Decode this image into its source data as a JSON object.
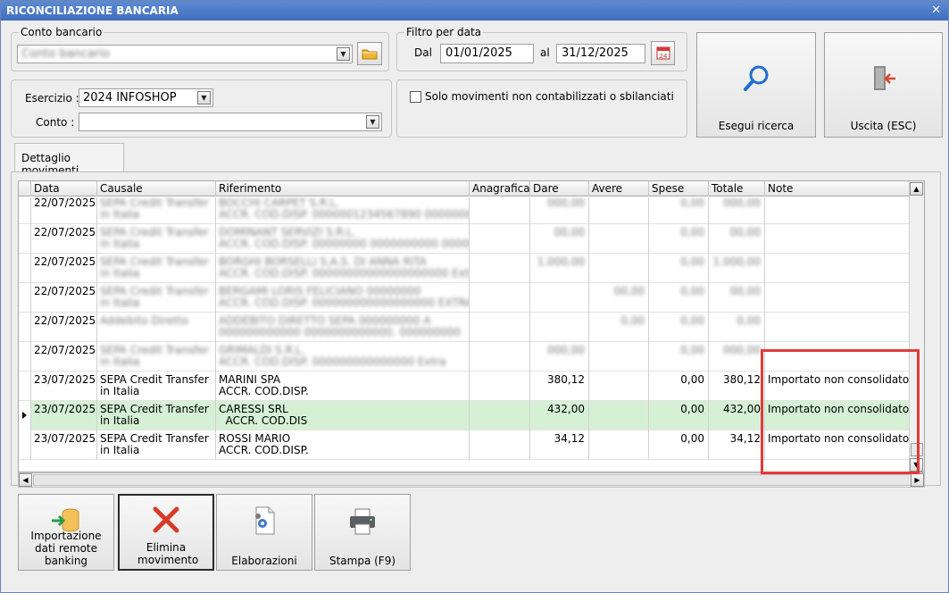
{
  "window": {
    "title": "RICONCILIAZIONE BANCARIA",
    "close": "✕"
  },
  "conto_bancario": {
    "group_label": "Conto bancario",
    "value": "Conto bancario"
  },
  "filtro": {
    "group_label": "Filtro per data",
    "dal_label": "Dal",
    "dal": "01/01/2025",
    "al_label": "al",
    "al": "31/12/2025"
  },
  "esercizio": {
    "label": "Esercizio :",
    "value": "2024 INFOSHOP"
  },
  "conto": {
    "label": "Conto :",
    "value": ""
  },
  "checkbox": {
    "label": "Solo movimenti non contabilizzati o sbilanciati",
    "checked": false
  },
  "buttons": {
    "search": "Esegui ricerca",
    "exit": "Uscita (ESC)"
  },
  "tab": {
    "label": "Dettaglio movimenti"
  },
  "grid": {
    "columns": [
      "Data",
      "Causale",
      "Riferimento",
      "Anagrafica",
      "Dare",
      "Avere",
      "Spese",
      "Totale",
      "Note"
    ],
    "rows": [
      {
        "data": "22/07/2025",
        "causale1": "SEPA Credit Transfer",
        "causale2": "in Italia",
        "rif1": "BOCCHI CARPET S.R.L.",
        "rif2": "ACCR. COD.DISP. 0000001234567890 00000000",
        "dare": "000,00",
        "avere": "",
        "spese": "0,00",
        "totale": "000,00",
        "note": ""
      },
      {
        "data": "22/07/2025",
        "causale1": "SEPA Credit Transfer",
        "causale2": "in Italia",
        "rif1": "DOMINANT SERVIZI S.R.L.",
        "rif2": "ACCR. COD.DISP. 00000000 0000000000 00000",
        "dare": "00,00",
        "avere": "",
        "spese": "0,00",
        "totale": "00,00",
        "note": ""
      },
      {
        "data": "22/07/2025",
        "causale1": "SEPA Credit Transfer",
        "causale2": "in Italia",
        "rif1": "BORGHI BORSELLI S.A.S. DI ANNA RITA",
        "rif2": "ACCR. COD.DISP. 00000000000000000000 Extra",
        "dare": "1.000,00",
        "avere": "",
        "spese": "0,00",
        "totale": "1.000,00",
        "note": ""
      },
      {
        "data": "22/07/2025",
        "causale1": "SEPA Credit Transfer",
        "causale2": "in Italia",
        "rif1": "BERGAMI LORIS FELICIANO 00000000",
        "rif2": "ACCR. COD.DISP. 000000000000000000 EXTRA",
        "dare": "",
        "avere": "00,00",
        "spese": "0,00",
        "totale": "00,00",
        "note": ""
      },
      {
        "data": "22/07/2025",
        "causale1": "Addebito Diretto",
        "causale2": "",
        "rif1": "ADDEBITO DIRETTO SEPA 000000000 A",
        "rif2": "000000000000 0000000000000. 000000000",
        "dare": "",
        "avere": "0,00",
        "spese": "0,00",
        "totale": "0,00",
        "note": ""
      },
      {
        "data": "22/07/2025",
        "causale1": "SEPA Credit Transfer",
        "causale2": "in Italia",
        "rif1": "GRIMALDI S.R.L.",
        "rif2": "ACCR. COD.DISP. 000000000000000 Extra",
        "dare": "000,00",
        "avere": "",
        "spese": "0,00",
        "totale": "000,00",
        "note": ""
      },
      {
        "data": "23/07/2025",
        "causale1": "SEPA Credit Transfer",
        "causale2": "in Italia",
        "rif1": "MARINI SPA",
        "rif2": "ACCR. COD.DISP.",
        "dare": "380,12",
        "avere": "",
        "spese": "0,00",
        "totale": "380,12",
        "note": "Importato non consolidato"
      },
      {
        "data": "23/07/2025",
        "causale1": "SEPA Credit Transfer",
        "causale2": "in Italia",
        "rif1": "CARESSI SRL",
        "rif2": "  ACCR. COD.DIS",
        "dare": "432,00",
        "avere": "",
        "spese": "0,00",
        "totale": "432,00",
        "note": "Importato non consolidato"
      },
      {
        "data": "23/07/2025",
        "causale1": "SEPA Credit Transfer",
        "causale2": "in Italia",
        "rif1": "ROSSI MARIO",
        "rif2": "ACCR. COD.DISP.",
        "dare": "34,12",
        "avere": "",
        "spese": "0,00",
        "totale": "34,12",
        "note": "Importato non consolidato"
      }
    ]
  },
  "bottom_buttons": {
    "import": "Importazione dati remote banking",
    "delete": "Elimina movimento",
    "elab": "Elaborazioni",
    "print": "Stampa (F9)"
  },
  "colors": {
    "title_bar": "#3f6ebf",
    "selected_row": "#d6f0d6",
    "highlight_box": "#e03b3b",
    "delete_icon": "#d83a2a"
  }
}
